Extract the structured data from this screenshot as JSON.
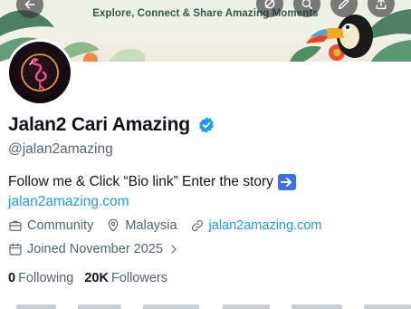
{
  "banner": {
    "tagline": "Explore, Connect & Share Amazing Moments"
  },
  "header_buttons": {
    "back_icon": "arrow-left-icon",
    "grok_icon": "grok-icon",
    "search_icon": "search-icon",
    "edit_icon": "pencil-icon",
    "share_icon": "share-icon"
  },
  "profile": {
    "name": "Jalan2 Cari Amazing",
    "handle": "@jalan2amazing",
    "verified": true,
    "bio_text": "Follow me & Click “Bio link” Enter the story",
    "bio_link": "jalan2amazing.com",
    "category": "Community",
    "location": "Malaysia",
    "website": "jalan2amazing.com",
    "joined": "Joined November 2025",
    "following_count": "0",
    "following_label": "Following",
    "followers_count": "20K",
    "followers_label": "Followers"
  },
  "colors": {
    "accent": "#1d9bf0",
    "verified_badge": "#1d9bf0",
    "secondary_text": "#536471",
    "primary_text": "#0f1419"
  }
}
